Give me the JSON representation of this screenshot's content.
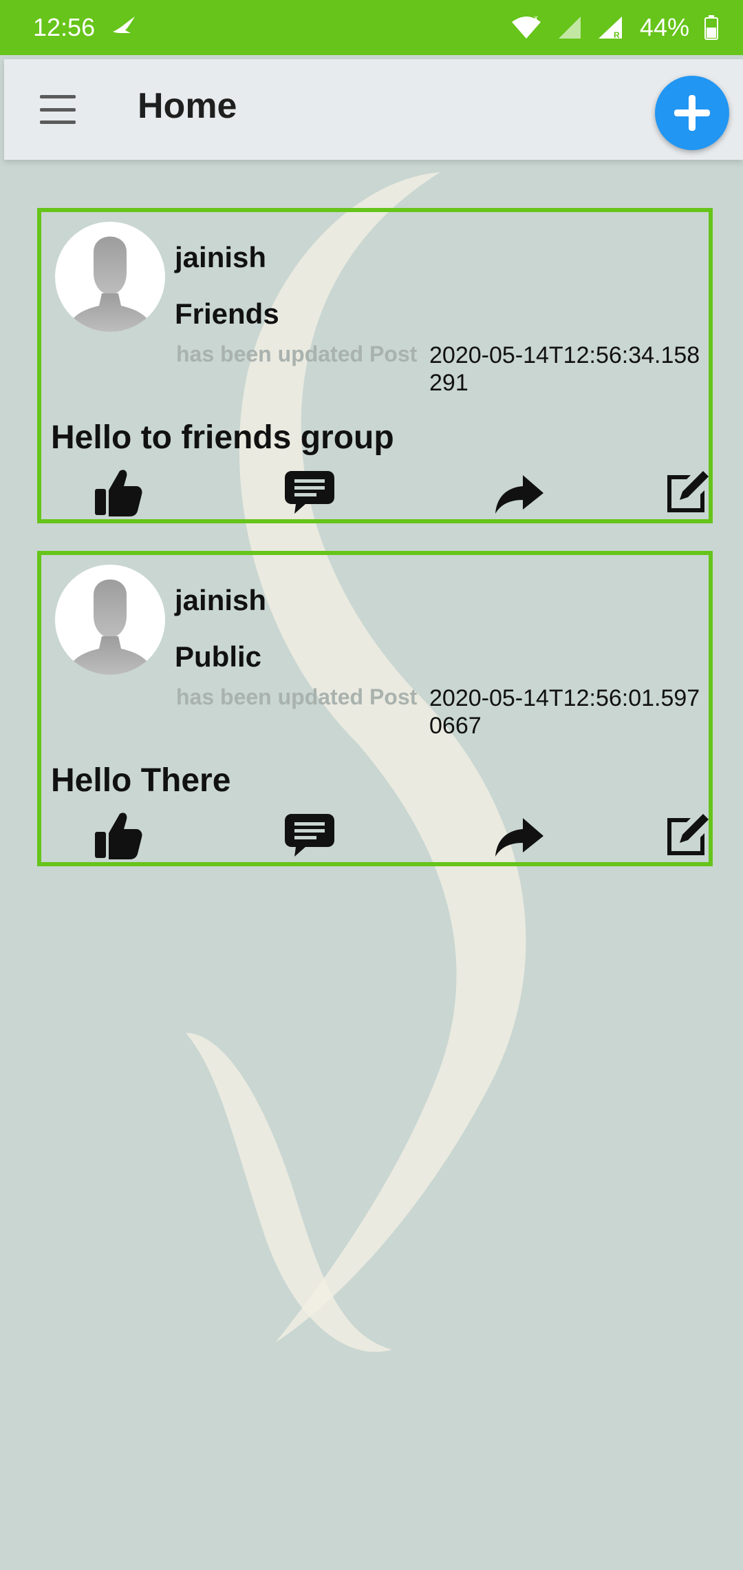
{
  "status_bar": {
    "time": "12:56",
    "battery": "44%"
  },
  "app_bar": {
    "title": "Home"
  },
  "posts": [
    {
      "username": "jainish",
      "audience": "Friends",
      "update_label": "has been updated Post",
      "timestamp": "2020-05-14T12:56:34.158291",
      "text": "Hello to friends group"
    },
    {
      "username": "jainish",
      "audience": "Public",
      "update_label": "has been updated Post",
      "timestamp": "2020-05-14T12:56:01.5970667",
      "text": "Hello There"
    }
  ],
  "icons": {
    "menu": "menu-icon",
    "add": "add-icon",
    "like": "thumbs-up-icon",
    "comment": "comment-icon",
    "share": "share-icon",
    "edit": "edit-icon"
  },
  "colors": {
    "status_bar": "#66c41a",
    "card_border": "#66c41a",
    "fab": "#2196f3",
    "background": "#c9d6d2"
  }
}
